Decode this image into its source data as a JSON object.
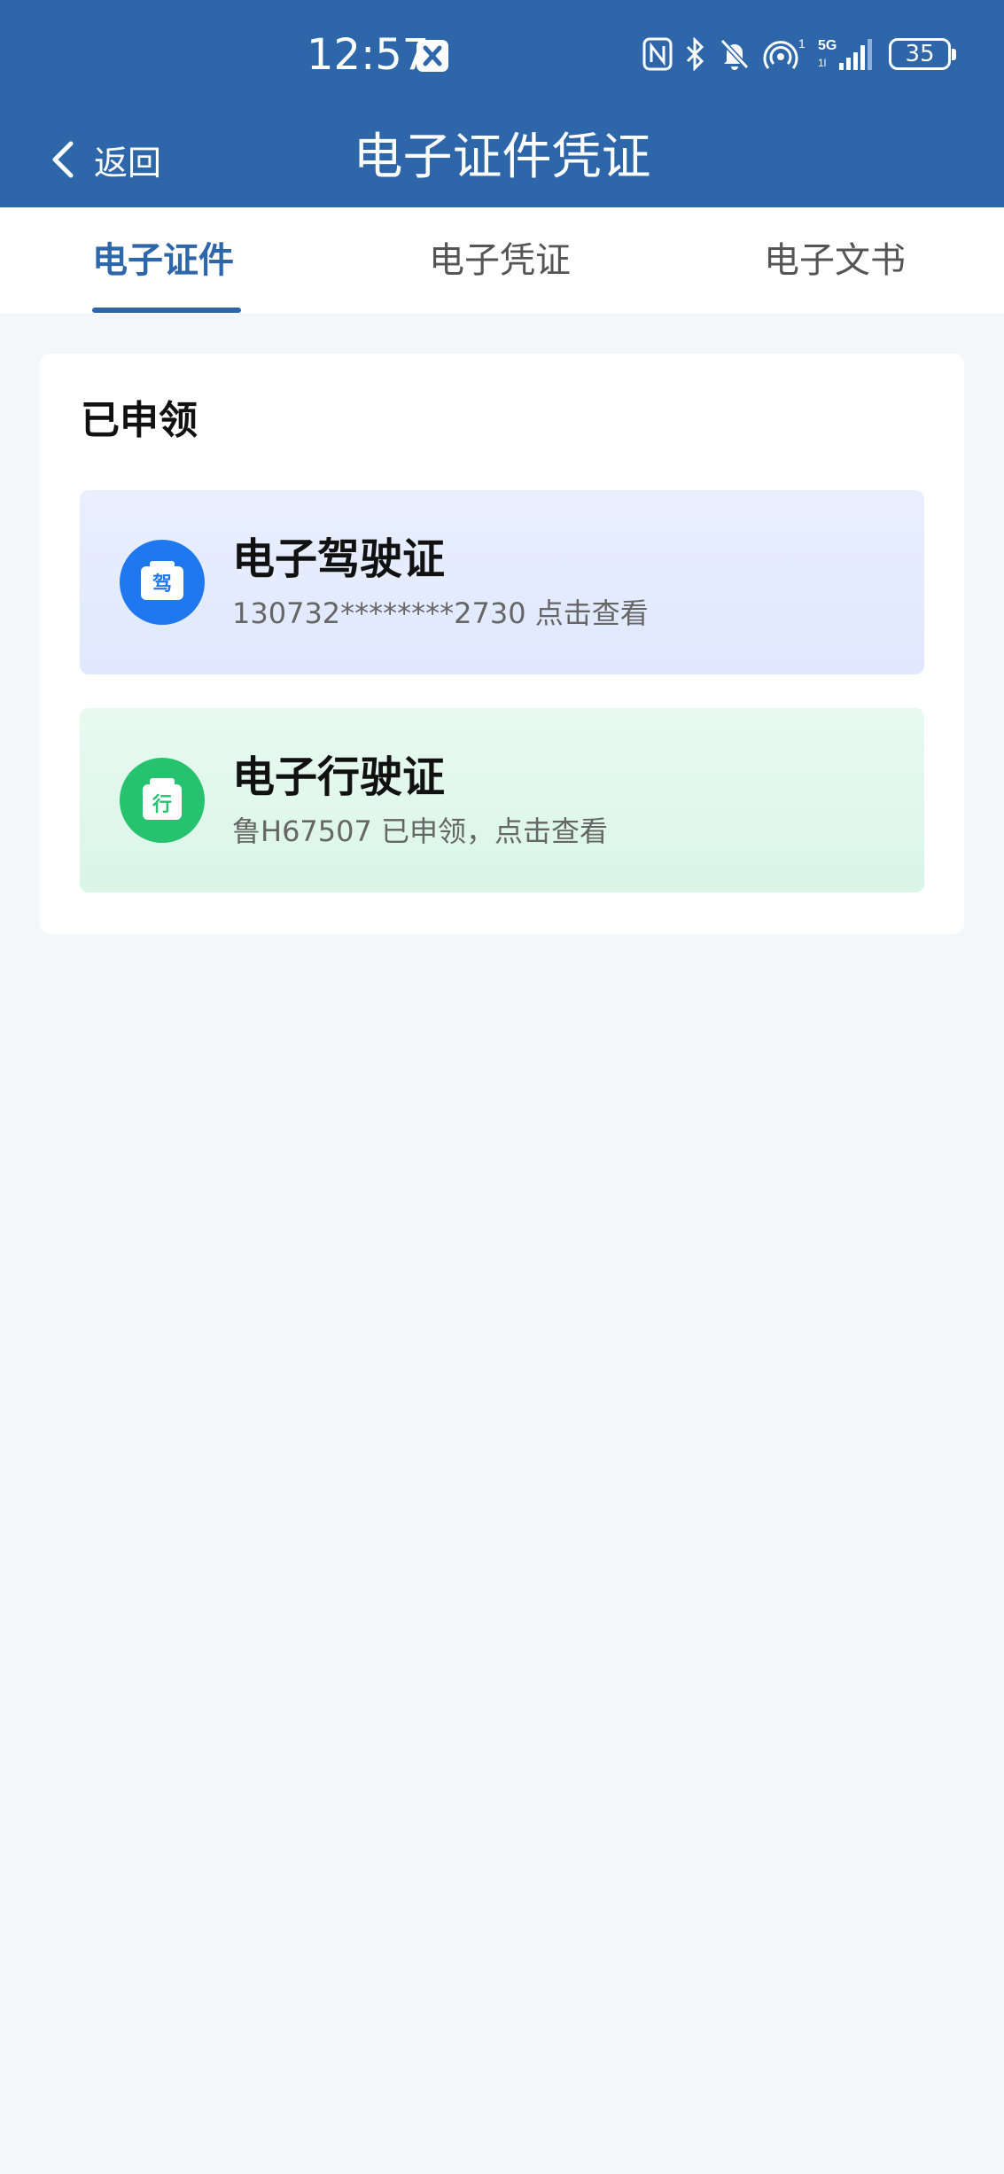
{
  "status_bar": {
    "time": "12:57",
    "icons": [
      "app-notification-icon",
      "nfc-icon",
      "bluetooth-icon",
      "mute-bell-icon",
      "hotspot-icon",
      "5g-signal-icon"
    ],
    "battery": "35"
  },
  "nav": {
    "back_label": "返回",
    "title": "电子证件凭证"
  },
  "tabs": [
    {
      "label": "电子证件",
      "active": true
    },
    {
      "label": "电子凭证",
      "active": false
    },
    {
      "label": "电子文书",
      "active": false
    }
  ],
  "section": {
    "title": "已申领",
    "items": [
      {
        "title": "电子驾驶证",
        "subtitle": "130732********2730 点击查看",
        "icon": "driver-license-icon",
        "icon_char": "驾",
        "color": "#1f78f0"
      },
      {
        "title": "电子行驶证",
        "subtitle": "鲁H67507 已申领，点击查看",
        "icon": "vehicle-license-icon",
        "icon_char": "行",
        "color": "#26c270"
      }
    ]
  },
  "colors": {
    "primary": "#2d66a9",
    "background": "#f3f7f9"
  }
}
